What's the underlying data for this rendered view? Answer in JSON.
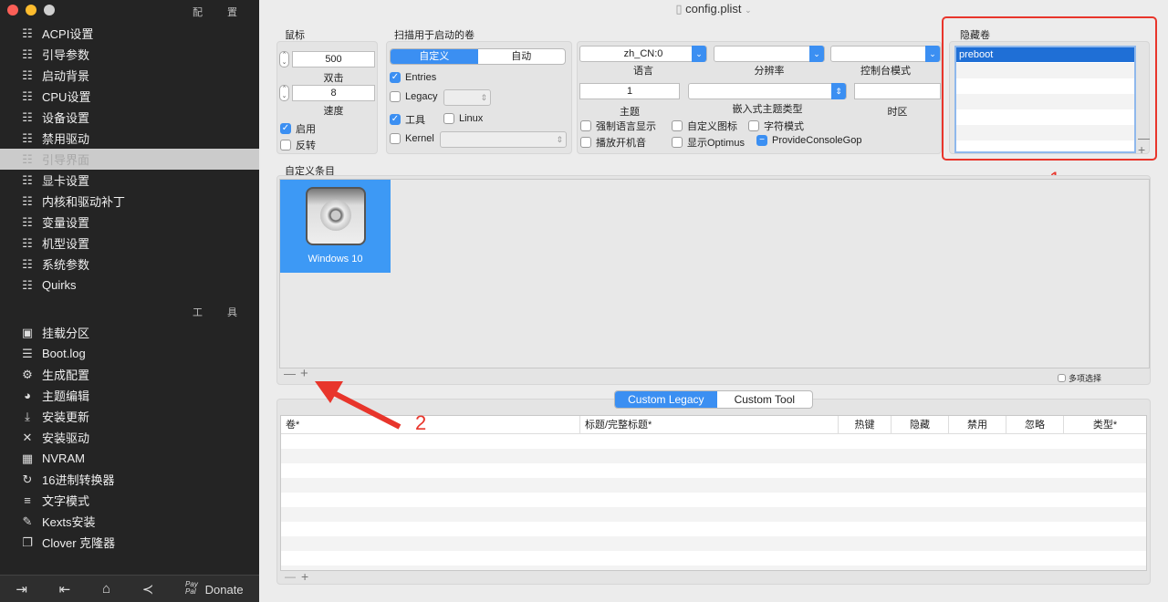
{
  "window": {
    "title": "config.plist"
  },
  "sidebar": {
    "config_header": "配 置",
    "config_items": [
      {
        "label": "ACPI设置",
        "icon": "list-icon"
      },
      {
        "label": "引导参数",
        "icon": "list-icon"
      },
      {
        "label": "启动背景",
        "icon": "list-icon"
      },
      {
        "label": "CPU设置",
        "icon": "list-icon"
      },
      {
        "label": "设备设置",
        "icon": "list-icon"
      },
      {
        "label": "禁用驱动",
        "icon": "list-icon"
      },
      {
        "label": "引导界面",
        "icon": "list-icon",
        "selected": true
      },
      {
        "label": "显卡设置",
        "icon": "list-icon"
      },
      {
        "label": "内核和驱动补丁",
        "icon": "list-icon"
      },
      {
        "label": "变量设置",
        "icon": "list-icon"
      },
      {
        "label": "机型设置",
        "icon": "list-icon"
      },
      {
        "label": "系统参数",
        "icon": "list-icon"
      },
      {
        "label": "Quirks",
        "icon": "list-icon"
      }
    ],
    "tools_header": "工 具",
    "tool_items": [
      {
        "label": "挂载分区",
        "icon": "disk-icon"
      },
      {
        "label": "Boot.log",
        "icon": "log-search-icon"
      },
      {
        "label": "生成配置",
        "icon": "gears-icon"
      },
      {
        "label": "主题编辑",
        "icon": "palette-icon"
      },
      {
        "label": "安装更新",
        "icon": "download-icon"
      },
      {
        "label": "安装驱动",
        "icon": "tools-icon"
      },
      {
        "label": "NVRAM",
        "icon": "chip-icon"
      },
      {
        "label": "16进制转换器",
        "icon": "refresh-icon"
      },
      {
        "label": "文字模式",
        "icon": "text-lines-icon"
      },
      {
        "label": "Kexts安装",
        "icon": "plug-icon"
      },
      {
        "label": "Clover 克隆器",
        "icon": "copy-icon"
      }
    ],
    "bottom": {
      "donate": "Donate",
      "paypal": "Pay Pal"
    }
  },
  "mouse": {
    "title": "鼠标",
    "double_click": "500",
    "double_click_label": "双击",
    "speed": "8",
    "speed_label": "速度",
    "enable": "启用",
    "enable_checked": true,
    "invert": "反转",
    "invert_checked": false
  },
  "scan": {
    "title": "扫描用于启动的卷",
    "seg_custom": "自定义",
    "seg_auto": "自动",
    "entries": "Entries",
    "legacy": "Legacy",
    "tools": "工具",
    "linux": "Linux",
    "kernel": "Kernel"
  },
  "gui": {
    "language": "zh_CN:0",
    "language_label": "语言",
    "resolution_label": "分辨率",
    "console_label": "控制台模式",
    "theme": "1",
    "theme_label": "主题",
    "embedded_label": "嵌入式主题类型",
    "timezone_label": "时区",
    "checks": [
      "强制语言显示",
      "自定义图标",
      "字符模式",
      "播放开机音",
      "显示Optimus",
      "ProvideConsoleGop"
    ]
  },
  "hidden": {
    "title": "隐藏卷",
    "items": [
      "preboot"
    ]
  },
  "custom_entries": {
    "title": "自定义条目",
    "items": [
      {
        "label": "Windows 10",
        "icon": "hard-disk-icon"
      }
    ],
    "multi_select": "多项选择"
  },
  "tabs": {
    "legacy": "Custom Legacy",
    "tool": "Custom Tool"
  },
  "table": {
    "columns": [
      "卷*",
      "标题/完整标题*",
      "热键",
      "隐藏",
      "禁用",
      "忽略",
      "类型*"
    ]
  },
  "annotations": {
    "one": "1",
    "two": "2"
  },
  "colors": {
    "accent": "#3b8ff2",
    "annotation": "#e8352b",
    "sidebar": "#242424"
  }
}
